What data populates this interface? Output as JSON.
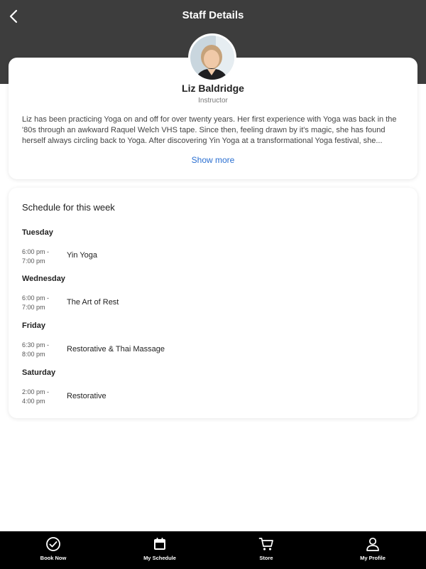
{
  "header": {
    "title": "Staff Details"
  },
  "profile": {
    "name": "Liz Baldridge",
    "role": "Instructor",
    "bio": "Liz has been practicing Yoga on and off for over twenty years. Her first experience with Yoga was back in the '80s through an awkward Raquel Welch VHS tape. Since then, feeling drawn by it's magic, she has found herself always circling back to Yoga. After discovering Yin Yoga at a transformational Yoga festival, she...",
    "show_more": "Show more"
  },
  "schedule": {
    "title": "Schedule for this week",
    "days": [
      {
        "day": "Tuesday",
        "time_start": "6:00 pm -",
        "time_end": "7:00 pm",
        "class": "Yin Yoga"
      },
      {
        "day": "Wednesday",
        "time_start": "6:00 pm -",
        "time_end": "7:00 pm",
        "class": "The Art of Rest"
      },
      {
        "day": "Friday",
        "time_start": "6:30 pm -",
        "time_end": "8:00 pm",
        "class": "Restorative & Thai Massage"
      },
      {
        "day": "Saturday",
        "time_start": "2:00 pm -",
        "time_end": "4:00 pm",
        "class": "Restorative"
      }
    ]
  },
  "tabbar": {
    "items": [
      {
        "label": "Book Now",
        "icon": "check-circle-icon"
      },
      {
        "label": "My Schedule",
        "icon": "calendar-icon"
      },
      {
        "label": "Store",
        "icon": "cart-icon"
      },
      {
        "label": "My Profile",
        "icon": "person-icon"
      }
    ]
  },
  "colors": {
    "header_bg": "#3d3d3d",
    "link": "#2a6fd1",
    "tabbar_bg": "#000000"
  }
}
